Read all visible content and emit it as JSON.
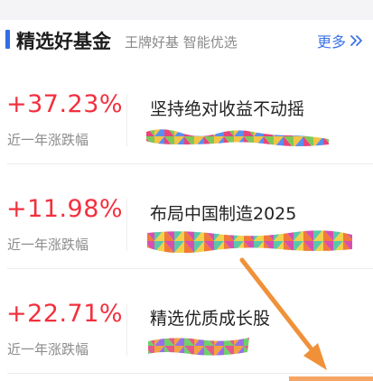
{
  "header": {
    "title": "精选好基金",
    "subtitle": "王牌好基 智能优选",
    "more_label": "更多",
    "more_icon": "chevron-double-right-icon"
  },
  "funds": [
    {
      "rate": "+37.23%",
      "rate_label": "近一年涨跌幅",
      "name": "坚持绝对收益不动摇"
    },
    {
      "rate": "+11.98%",
      "rate_label": "近一年涨跌幅",
      "name": "布局中国制造2025"
    },
    {
      "rate": "+22.71%",
      "rate_label": "近一年涨跌幅",
      "name": "精选优质成长股"
    }
  ],
  "colors": {
    "accent_blue": "#2f6fe4",
    "rate_red": "#f2303e",
    "annotation_orange": "#f0913a"
  }
}
